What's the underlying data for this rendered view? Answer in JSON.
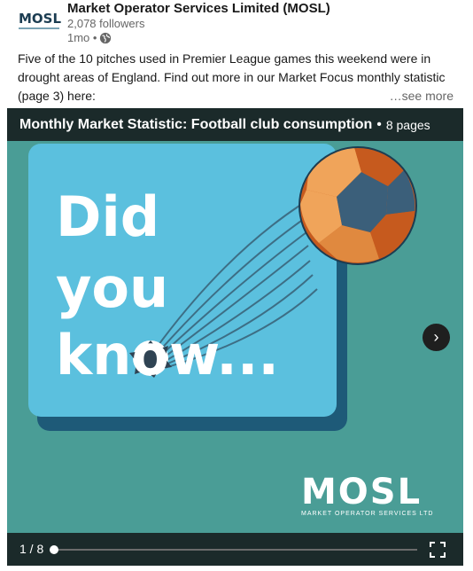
{
  "post": {
    "logo_text": "MOSL",
    "author": "Market Operator Services Limited (MOSL)",
    "followers": "2,078 followers",
    "time": "1mo •",
    "body": "Five of the 10 pitches used in Premier League games this weekend were in drought areas of England. Find out more in our Market Focus monthly statistic (page 3) here:",
    "see_more": "…see more"
  },
  "document": {
    "title": "Monthly Market Statistic: Football club consumption",
    "separator": "•",
    "pages": "8 pages",
    "slide": {
      "line1": "Did",
      "line2": "you",
      "line3": "know...",
      "brand": "MOSL",
      "brand_sub": "MARKET OPERATOR SERVICES LTD"
    },
    "next_icon": "›",
    "page_counter": "1 / 8",
    "progress": 0.125
  },
  "colors": {
    "slide_bg": "#4a9d96",
    "card": "#5bc0de",
    "bar": "#1b2a2a",
    "ball_orange": "#c65a1e",
    "ball_light": "#f0a45a",
    "ball_blue": "#3b5f7a"
  }
}
